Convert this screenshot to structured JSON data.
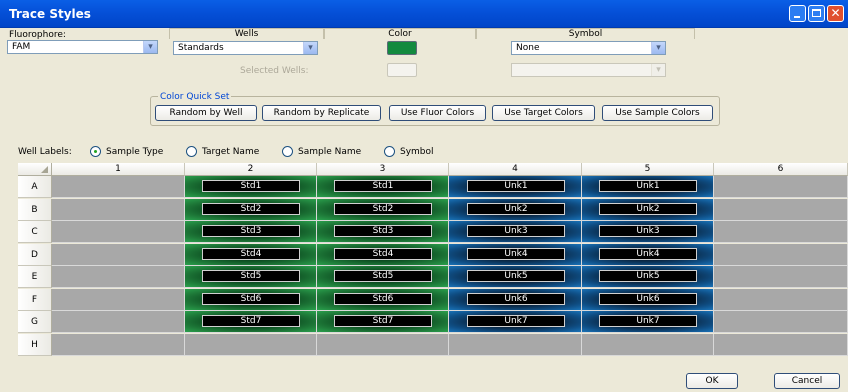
{
  "window": {
    "title": "Trace Styles"
  },
  "fluorophore": {
    "label": "Fluorophore:",
    "value": "FAM"
  },
  "headers": {
    "wells": "Wells",
    "color": "Color",
    "symbol": "Symbol"
  },
  "wells": {
    "value": "Standards",
    "selected_label": "Selected Wells:"
  },
  "colors": {
    "trace": "#138a3f",
    "selected_empty": "#f4f3ee"
  },
  "symbol": {
    "value": "None",
    "selected_value": ""
  },
  "quick_set": {
    "title": "Color Quick Set",
    "buttons": [
      "Random by Well",
      "Random by Replicate",
      "Use Fluor Colors",
      "Use Target Colors",
      "Use Sample Colors"
    ]
  },
  "well_labels": {
    "label": "Well Labels:",
    "options": [
      "Sample Type",
      "Target Name",
      "Sample Name",
      "Symbol"
    ],
    "selected": "Sample Type"
  },
  "plate": {
    "columns": [
      "1",
      "2",
      "3",
      "4",
      "5",
      "6"
    ],
    "rows": [
      "A",
      "B",
      "C",
      "D",
      "E",
      "F",
      "G",
      "H"
    ],
    "wells": [
      [
        "",
        "Std1",
        "Std1",
        "Unk1",
        "Unk1",
        ""
      ],
      [
        "",
        "Std2",
        "Std2",
        "Unk2",
        "Unk2",
        ""
      ],
      [
        "",
        "Std3",
        "Std3",
        "Unk3",
        "Unk3",
        ""
      ],
      [
        "",
        "Std4",
        "Std4",
        "Unk4",
        "Unk4",
        ""
      ],
      [
        "",
        "Std5",
        "Std5",
        "Unk5",
        "Unk5",
        ""
      ],
      [
        "",
        "Std6",
        "Std6",
        "Unk6",
        "Unk6",
        ""
      ],
      [
        "",
        "Std7",
        "Std7",
        "Unk7",
        "Unk7",
        ""
      ],
      [
        "",
        "",
        "",
        "",
        "",
        ""
      ]
    ]
  },
  "footer": {
    "ok": "OK",
    "cancel": "Cancel"
  }
}
